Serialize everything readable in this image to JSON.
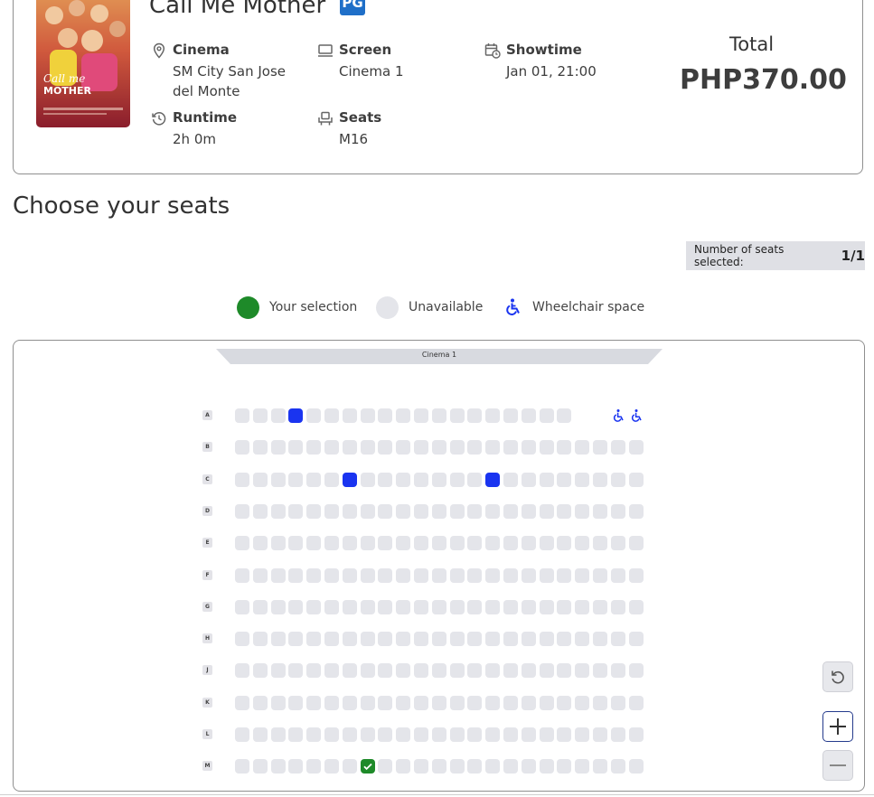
{
  "booking": {
    "title": "Call Me Mother",
    "rating": "PG",
    "poster_text": "Call me MOTHER",
    "cinema_label": "Cinema",
    "cinema_value_line1": "SM City San Jose",
    "cinema_value_line2": "del Monte",
    "screen_label": "Screen",
    "screen_value": "Cinema 1",
    "showtime_label": "Showtime",
    "showtime_value": "Jan 01, 21:00",
    "runtime_label": "Runtime",
    "runtime_value": "2h 0m",
    "seats_label": "Seats",
    "seats_value": "M16",
    "total_label": "Total",
    "total_value": "PHP370.00"
  },
  "section_title": "Choose your seats",
  "seat_counter": {
    "label": "Number of seats selected:",
    "value": "1/1"
  },
  "legend": {
    "selection": "Your selection",
    "unavailable": "Unavailable",
    "wheelchair": "Wheelchair space"
  },
  "colors": {
    "selection": "#1e8a29",
    "unavailable": "#e4e5ea",
    "wheelchair": "#1a34f0",
    "rating_badge": "#1f6fc8"
  },
  "seatmap": {
    "screen_name": "Cinema 1",
    "rows": [
      "A",
      "B",
      "C",
      "D",
      "E",
      "F",
      "G",
      "H",
      "J",
      "K",
      "L",
      "M"
    ],
    "seats_per_row": 23,
    "special_seats": [
      {
        "row": "A",
        "seat": 4,
        "state": "blue"
      },
      {
        "row": "A",
        "seat": 22,
        "state": "wheelchair"
      },
      {
        "row": "A",
        "seat": 23,
        "state": "wheelchair"
      },
      {
        "row": "C",
        "seat": 7,
        "state": "blue"
      },
      {
        "row": "C",
        "seat": 15,
        "state": "blue"
      },
      {
        "row": "M",
        "seat": 8,
        "state": "selected"
      }
    ],
    "hidden_seats": [
      {
        "row": "A",
        "seat": 20
      },
      {
        "row": "A",
        "seat": 21
      }
    ]
  },
  "controls": {
    "reset_icon": "rotate-ccw-icon",
    "zoom_in_icon": "plus-icon",
    "zoom_out_icon": "minus-icon"
  }
}
